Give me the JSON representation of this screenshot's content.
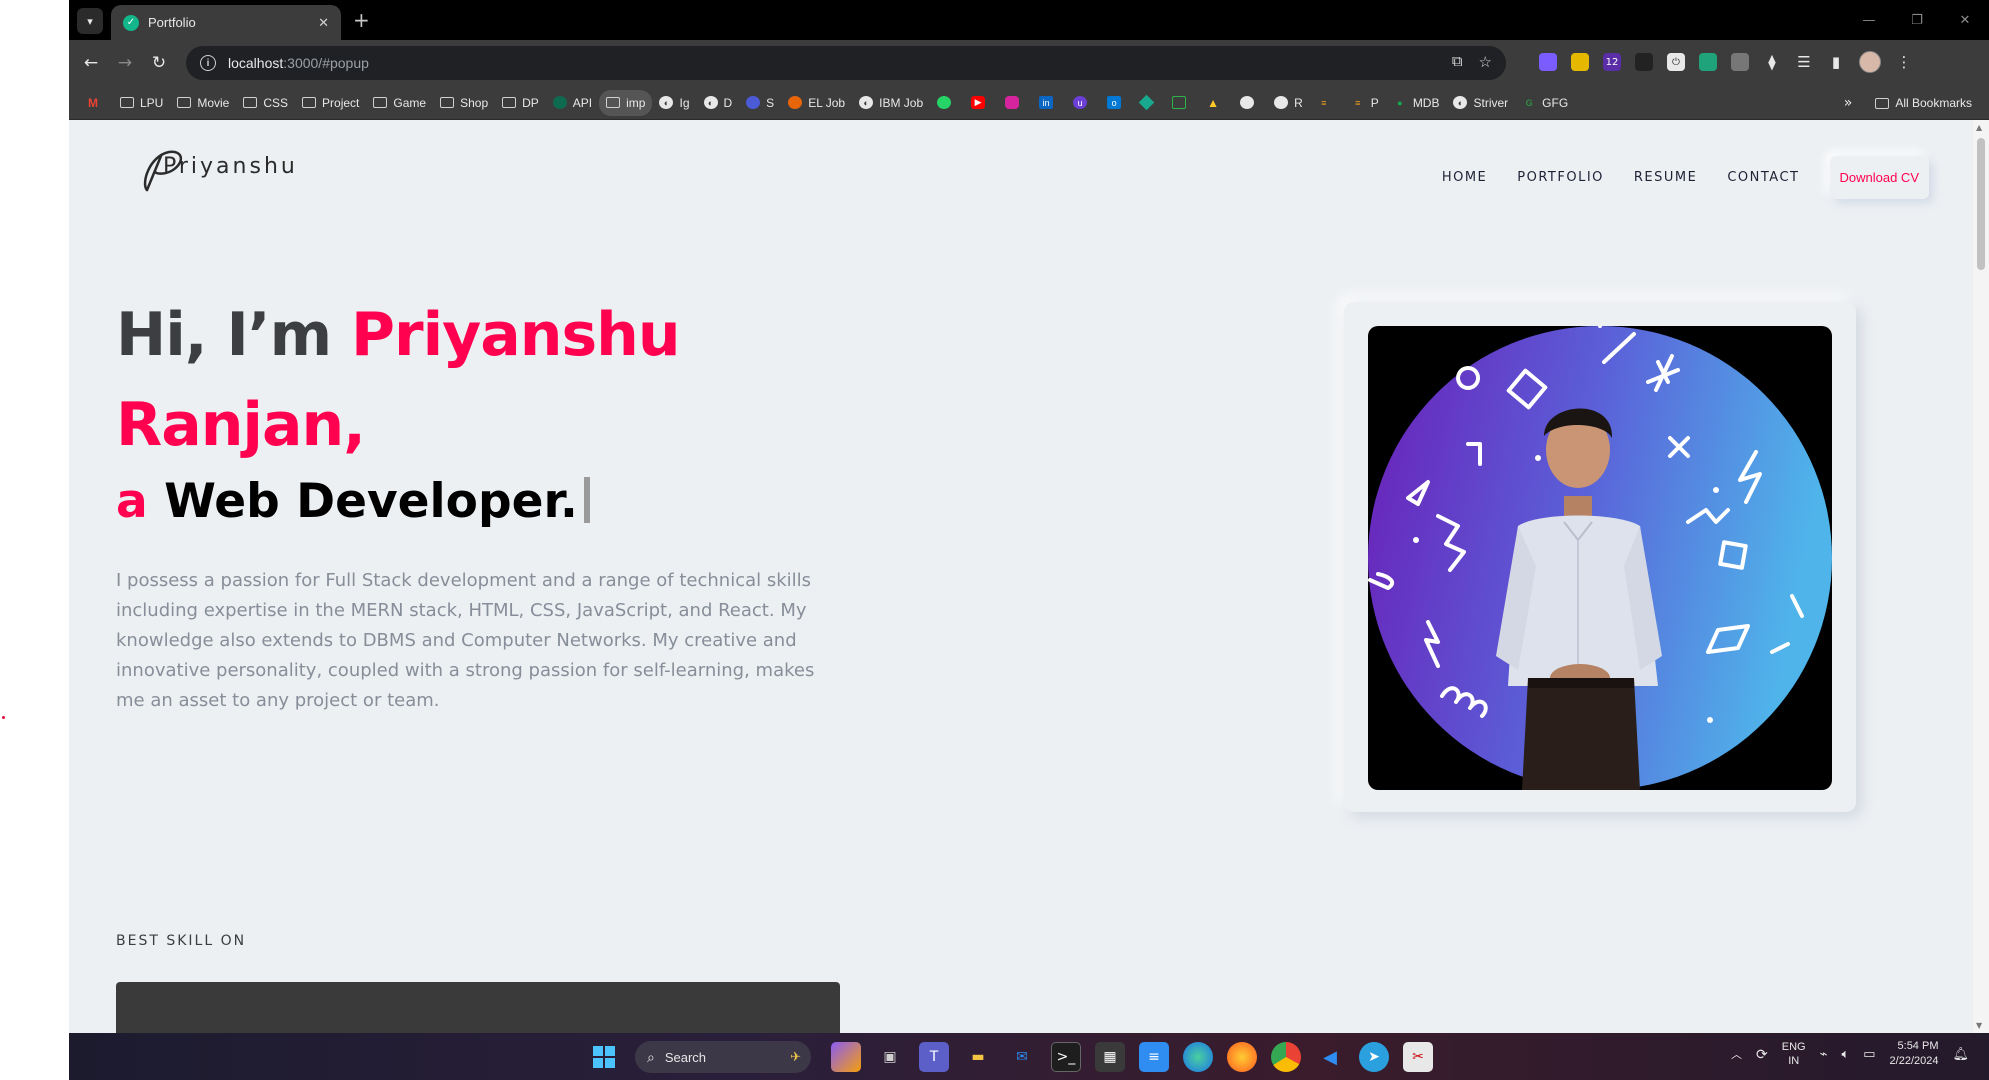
{
  "browser": {
    "tab_title": "Portfolio",
    "url_host": "localhost",
    "url_path": ":3000/#popup",
    "bookmarks": [
      {
        "label": "",
        "icon": "gmail-icon",
        "color": "#ea4335"
      },
      {
        "label": "LPU",
        "icon": "folder-icon"
      },
      {
        "label": "Movie",
        "icon": "folder-icon"
      },
      {
        "label": "CSS",
        "icon": "folder-icon"
      },
      {
        "label": "Project",
        "icon": "folder-icon"
      },
      {
        "label": "Game",
        "icon": "folder-icon"
      },
      {
        "label": "Shop",
        "icon": "folder-icon"
      },
      {
        "label": "DP",
        "icon": "folder-icon"
      },
      {
        "label": "API",
        "icon": "api-icon"
      },
      {
        "label": "imp",
        "icon": "folder-icon"
      },
      {
        "label": "Ig",
        "icon": "globe-icon"
      },
      {
        "label": "D",
        "icon": "globe-icon"
      },
      {
        "label": "S",
        "icon": "s-icon"
      },
      {
        "label": "EL Job",
        "icon": "job-icon"
      },
      {
        "label": "IBM Job",
        "icon": "globe-icon"
      }
    ],
    "bookmark_tail": [
      {
        "label": "R",
        "icon": "github-icon"
      },
      {
        "label": "P",
        "icon": "p-icon"
      },
      {
        "label": "MDB",
        "icon": "mongodb-icon"
      },
      {
        "label": "Striver",
        "icon": "globe-icon"
      },
      {
        "label": "GFG",
        "icon": "gfg-icon"
      }
    ],
    "all_bookmarks": "All Bookmarks"
  },
  "site": {
    "logo": "Priyanshu",
    "nav": [
      "HOME",
      "PORTFOLIO",
      "RESUME",
      "CONTACT"
    ],
    "download_cv": "Download CV",
    "hero": {
      "greeting": "Hi, I’m ",
      "name_first": "Priyanshu",
      "name_last": "Ranjan,",
      "article": "a",
      "role": "Web Developer.",
      "description": "I possess a passion for Full Stack development and a range of technical skills including expertise in the MERN stack, HTML, CSS, JavaScript, and React. My knowledge also extends to DBMS and Computer Networks. My creative and innovative personality, coupled with a strong passion for self-learning, makes me an asset to any project or team."
    },
    "best_skill": "BEST SKILL ON",
    "accent_color": "#ff014f"
  },
  "taskbar": {
    "search_label": "Search",
    "lang_line1": "ENG",
    "lang_line2": "IN",
    "time": "5:54 PM",
    "date": "2/22/2024"
  }
}
